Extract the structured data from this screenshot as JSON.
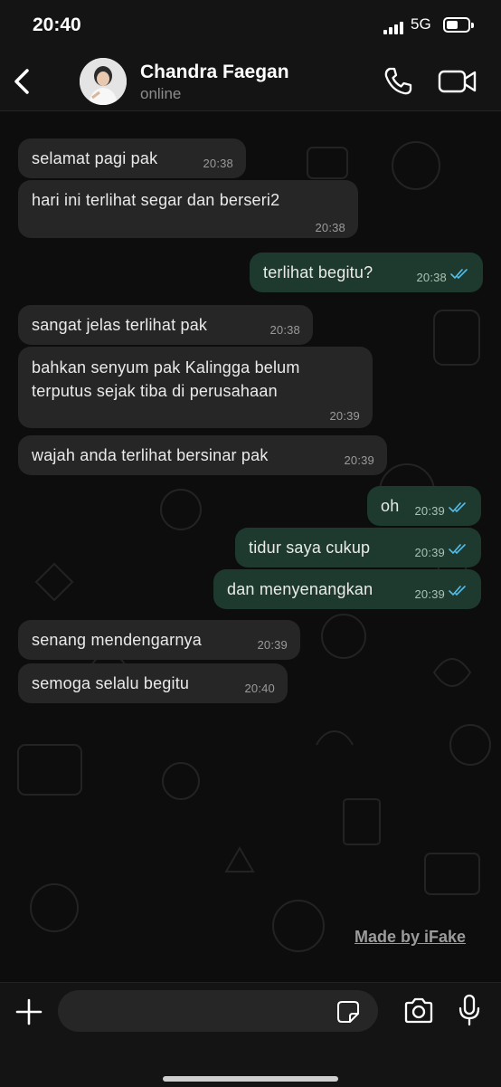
{
  "status_bar": {
    "time": "20:40",
    "network": "5G",
    "battery_level": 0.55
  },
  "header": {
    "contact_name": "Chandra Faegan",
    "contact_status": "online"
  },
  "messages": [
    {
      "dir": "in",
      "text": "selamat pagi pak",
      "time": "20:38"
    },
    {
      "dir": "in",
      "text": "hari ini terlihat segar dan berseri2",
      "time": "20:38"
    },
    {
      "dir": "out",
      "text": "terlihat begitu?",
      "time": "20:38",
      "status": "read"
    },
    {
      "dir": "in",
      "text": "sangat jelas terlihat pak",
      "time": "20:38"
    },
    {
      "dir": "in",
      "text": "bahkan senyum pak Kalingga belum terputus sejak tiba di perusahaan",
      "time": "20:39"
    },
    {
      "dir": "in",
      "text": "wajah anda terlihat bersinar pak",
      "time": "20:39"
    },
    {
      "dir": "out",
      "text": "oh",
      "time": "20:39",
      "status": "read"
    },
    {
      "dir": "out",
      "text": "tidur saya cukup",
      "time": "20:39",
      "status": "read"
    },
    {
      "dir": "out",
      "text": "dan menyenangkan",
      "time": "20:39",
      "status": "read"
    },
    {
      "dir": "in",
      "text": "senang mendengarnya",
      "time": "20:39"
    },
    {
      "dir": "in",
      "text": "semoga selalu begitu",
      "time": "20:40"
    }
  ],
  "watermark": "Made by iFake",
  "composer": {
    "value": "",
    "placeholder": ""
  },
  "colors": {
    "incoming_bubble": "#262626",
    "outgoing_bubble": "#1e3a2e",
    "read_ticks": "#53bdeb"
  }
}
